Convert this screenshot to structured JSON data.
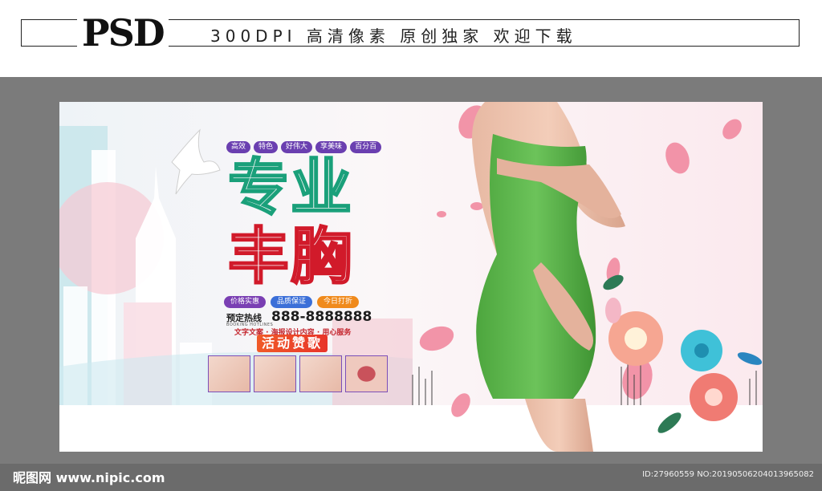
{
  "header": {
    "logo": "PSD",
    "tagline": "300DPI  高清像素  原创独家  欢迎下载"
  },
  "banner": {
    "tags": [
      "高效",
      "特色",
      "好伟大",
      "享美味",
      "百分百"
    ],
    "headline_line1": "专业",
    "headline_line2": "丰胸",
    "sub_tags": [
      {
        "label": "价格实惠",
        "color": "#7a3fb3"
      },
      {
        "label": "品质保证",
        "color": "#3b6fd8"
      },
      {
        "label": "今日打折",
        "color": "#f08a1c"
      }
    ],
    "hotline_label": "预定热线",
    "hotline_en": "BOOKING HOTLINES",
    "hotline_number": "888-8888888",
    "copy_line": "文字文案 · 海报设计内容 · 用心服务",
    "praise": "活动赞歌"
  },
  "watermark": {
    "left": "昵图网 www.nipic.com",
    "right": "ID:27960559 NO:20190506204013965082"
  },
  "colors": {
    "page_bg": "#7b7b7b",
    "dress_green": "#5fb84f",
    "accent_purple": "#6a3fb0"
  }
}
